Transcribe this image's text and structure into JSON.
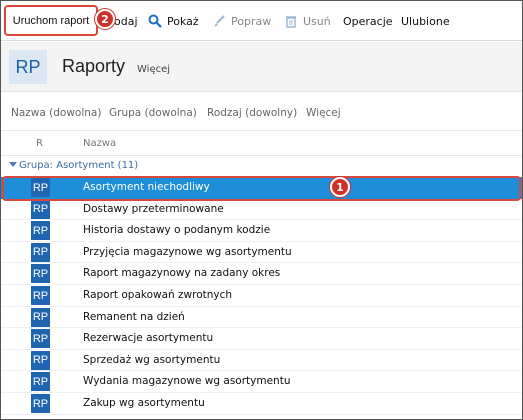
{
  "toolbar": {
    "run_report": "Uruchom raport",
    "add_partial": "odaj",
    "show": "Pokaż",
    "edit": "Popraw",
    "delete": "Usuń",
    "operations": "Operacje",
    "favorites": "Ulubione"
  },
  "badges": {
    "one": "1",
    "two": "2"
  },
  "header": {
    "icon_text": "RP",
    "title": "Raporty",
    "more": "Więcej"
  },
  "filters": [
    "Nazwa (dowolna)",
    "Grupa (dowolna)",
    "Rodzaj (dowolny)",
    "Więcej"
  ],
  "columns": {
    "r": "R",
    "name": "Nazwa"
  },
  "group": {
    "label": "Grupa: Asortyment (11)"
  },
  "row_icon": "RP",
  "rows": [
    "Asortyment niechodliwy",
    "Dostawy przeterminowane",
    "Historia dostawy o podanym kodzie",
    "Przyjęcia magazynowe wg asortymentu",
    "Raport magazynowy na zadany okres",
    "Raport opakowań zwrotnych",
    "Remanent na dzień",
    "Rezerwacje asortymentu",
    "Sprzedaż wg asortymentu",
    "Wydania magazynowe wg asortymentu",
    "Zakup wg asortymentu"
  ],
  "selected_row": 0,
  "colors": {
    "selection": "#1f8ed8",
    "highlight": "#d9463b",
    "icon_blue": "#1f66b1"
  }
}
